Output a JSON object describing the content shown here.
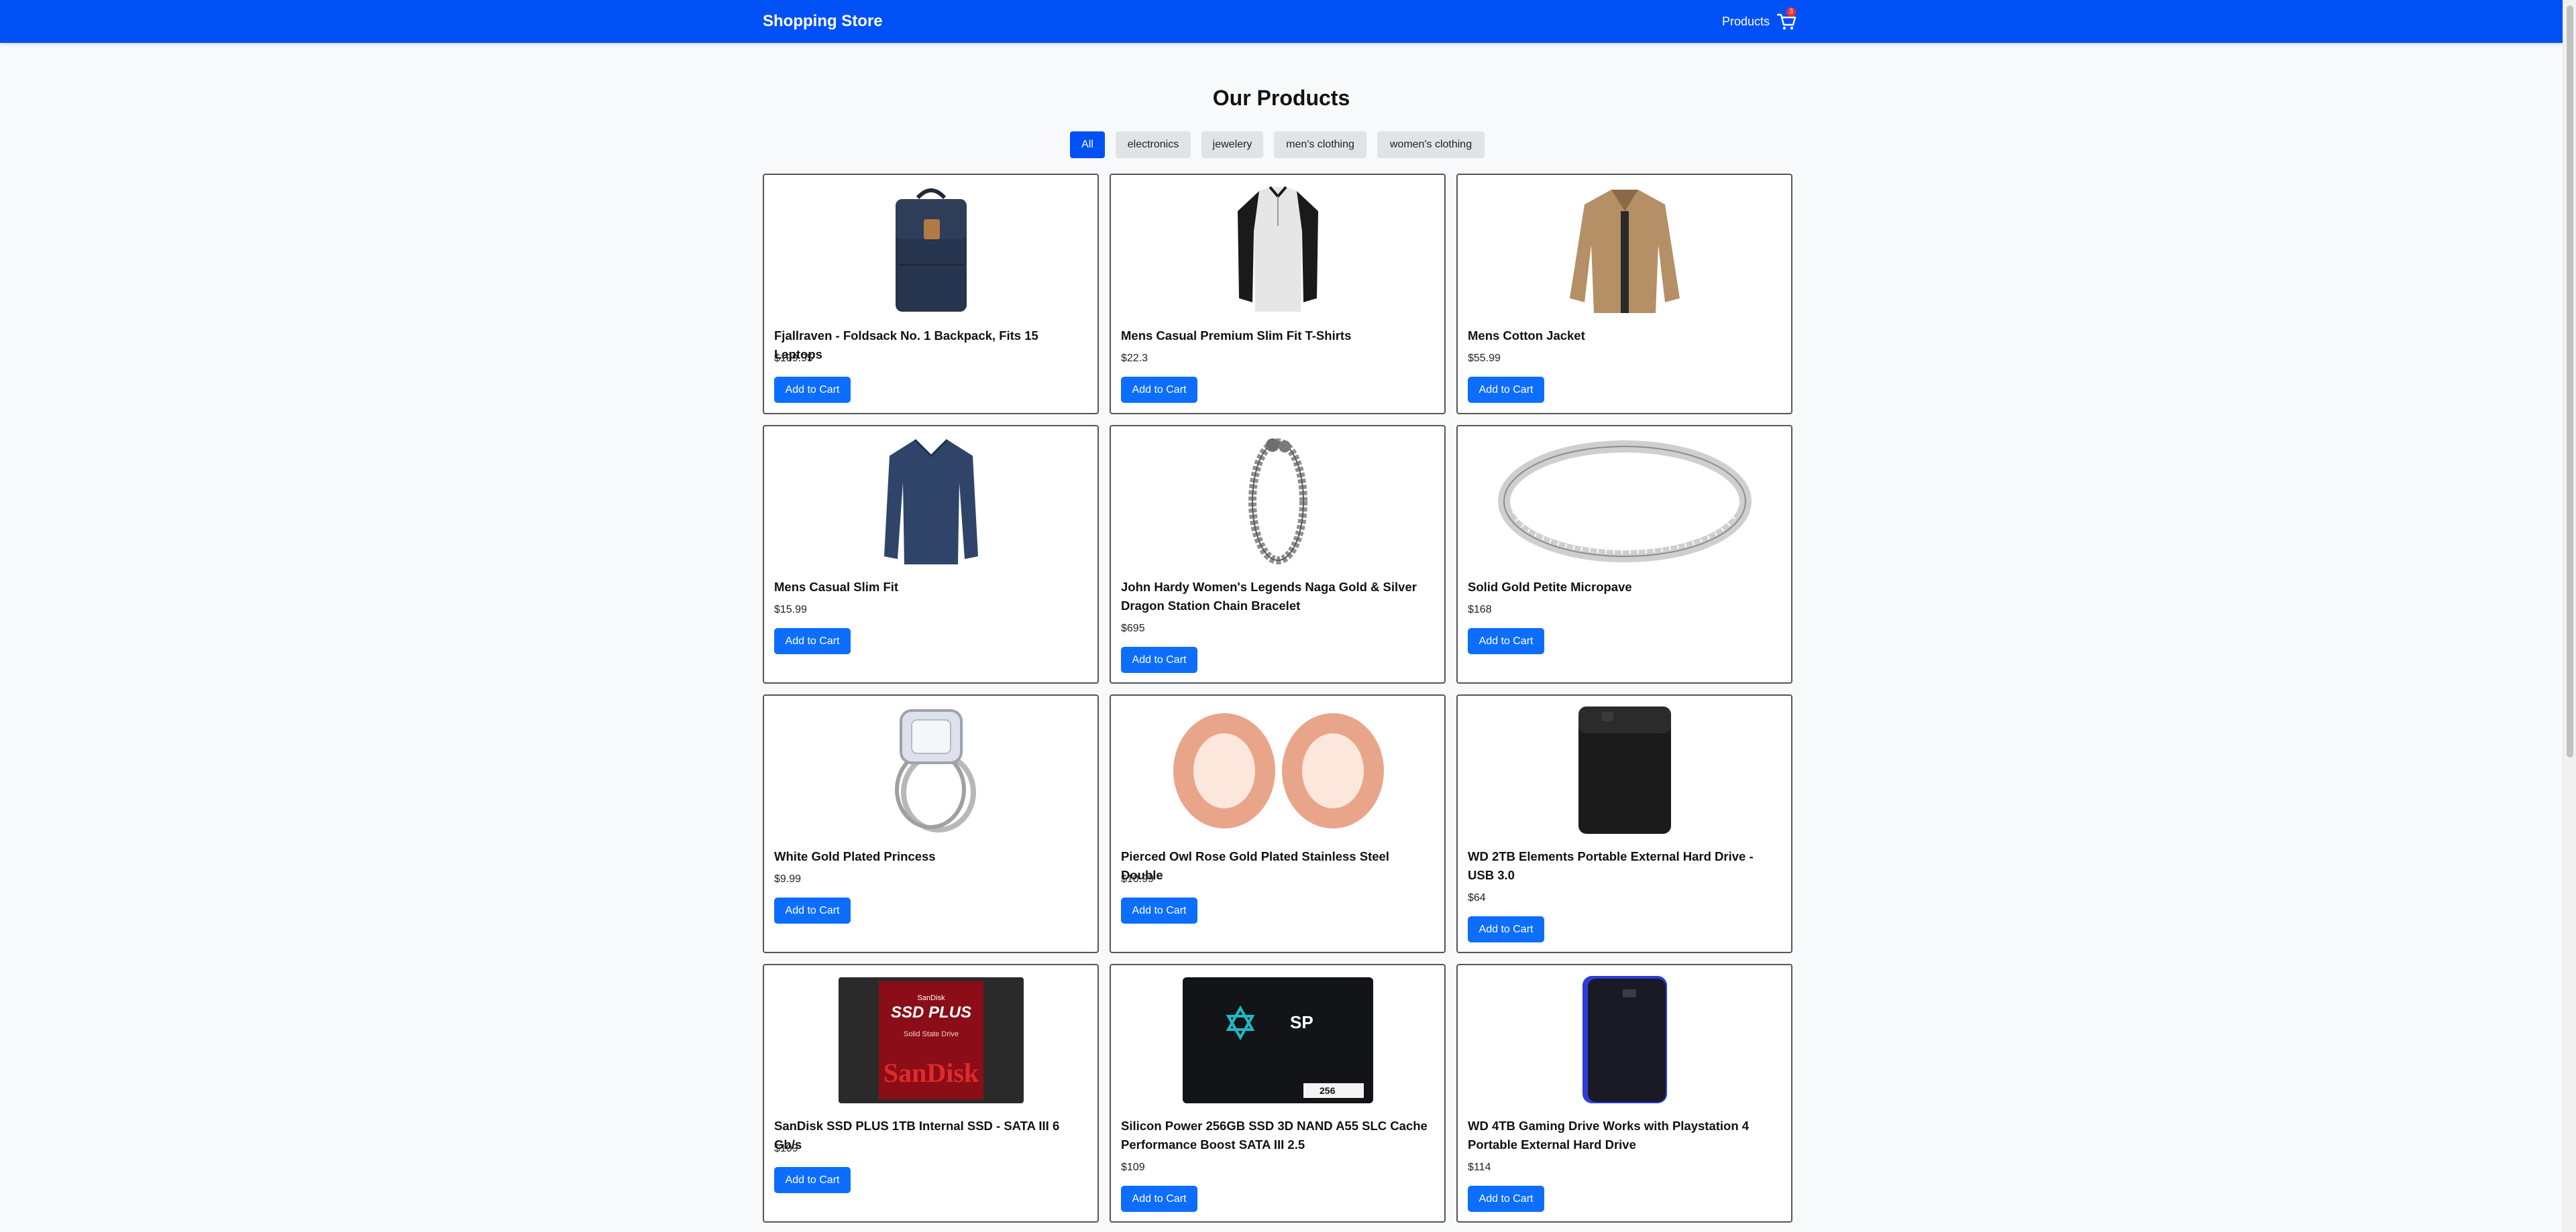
{
  "navbar": {
    "brand": "Shopping Store",
    "products_link": "Products",
    "cart_count": "3"
  },
  "page": {
    "title": "Our Products"
  },
  "filters": [
    "All",
    "electronics",
    "jewelery",
    "men's clothing",
    "women's clothing"
  ],
  "active_filter": "All",
  "add_to_cart_label": "Add to Cart",
  "products": [
    {
      "title": "Fjallraven - Foldsack No. 1 Backpack, Fits 15 Laptops",
      "price": "$109.95",
      "image": "backpack"
    },
    {
      "title": "Mens Casual Premium Slim Fit T-Shirts",
      "price": "$22.3",
      "image": "tshirt"
    },
    {
      "title": "Mens Cotton Jacket",
      "price": "$55.99",
      "image": "jacket"
    },
    {
      "title": "Mens Casual Slim Fit",
      "price": "$15.99",
      "image": "longsleeve"
    },
    {
      "title": "John Hardy Women's Legends Naga Gold & Silver Dragon Station Chain Bracelet",
      "price": "$695",
      "image": "bracelet"
    },
    {
      "title": "Solid Gold Petite Micropave",
      "price": "$168",
      "image": "ring-band"
    },
    {
      "title": "White Gold Plated Princess",
      "price": "$9.99",
      "image": "ring-princess"
    },
    {
      "title": "Pierced Owl Rose Gold Plated Stainless Steel Double",
      "price": "$10.99",
      "image": "plugs"
    },
    {
      "title": "WD 2TB Elements Portable External Hard Drive - USB 3.0",
      "price": "$64",
      "image": "hdd-black"
    },
    {
      "title": "SanDisk SSD PLUS 1TB Internal SSD - SATA III 6 Gb/s",
      "price": "$109",
      "image": "ssd-sandisk"
    },
    {
      "title": "Silicon Power 256GB SSD 3D NAND A55 SLC Cache Performance Boost SATA III 2.5",
      "price": "$109",
      "image": "ssd-sp"
    },
    {
      "title": "WD 4TB Gaming Drive Works with Playstation 4 Portable External Hard Drive",
      "price": "$114",
      "image": "hdd-blue"
    }
  ],
  "image_text": {
    "sandisk_top": "SanDisk",
    "sandisk_model": "SSD PLUS",
    "sandisk_sub": "Solid State Drive",
    "sandisk_brand": "SanDisk",
    "sp_logo": "SP",
    "sp_capacity": "256"
  },
  "colors": {
    "navbar": "#0051f5",
    "button": "#0d6efd",
    "badge": "#ff2a2a"
  }
}
